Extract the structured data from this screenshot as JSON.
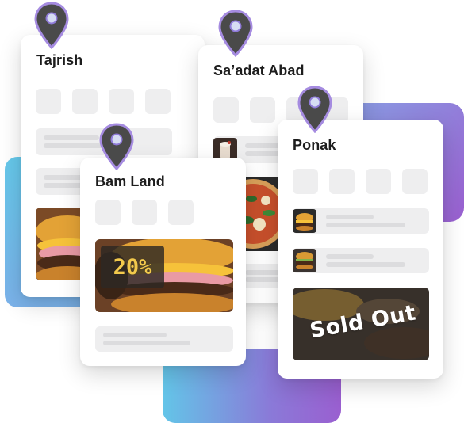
{
  "cards": [
    {
      "title": "Tajrish",
      "pin": "map-pin-icon"
    },
    {
      "title": "Sa’adat Abad",
      "pin": "map-pin-icon"
    },
    {
      "title": "Bam Land",
      "pin": "map-pin-icon",
      "discount_badge": "20%"
    },
    {
      "title": "Ponak",
      "pin": "map-pin-icon",
      "sold_out_label": "Sold Out"
    }
  ],
  "colors": {
    "gradient_blue": "#5fc6e8",
    "gradient_purple": "#9a5fd0",
    "pin_body": "#4a4a4a",
    "pin_outline": "#a58be0",
    "placeholder": "#eeeeef",
    "placeholder_line": "#dcdcde",
    "badge_text": "#f2c94c"
  }
}
